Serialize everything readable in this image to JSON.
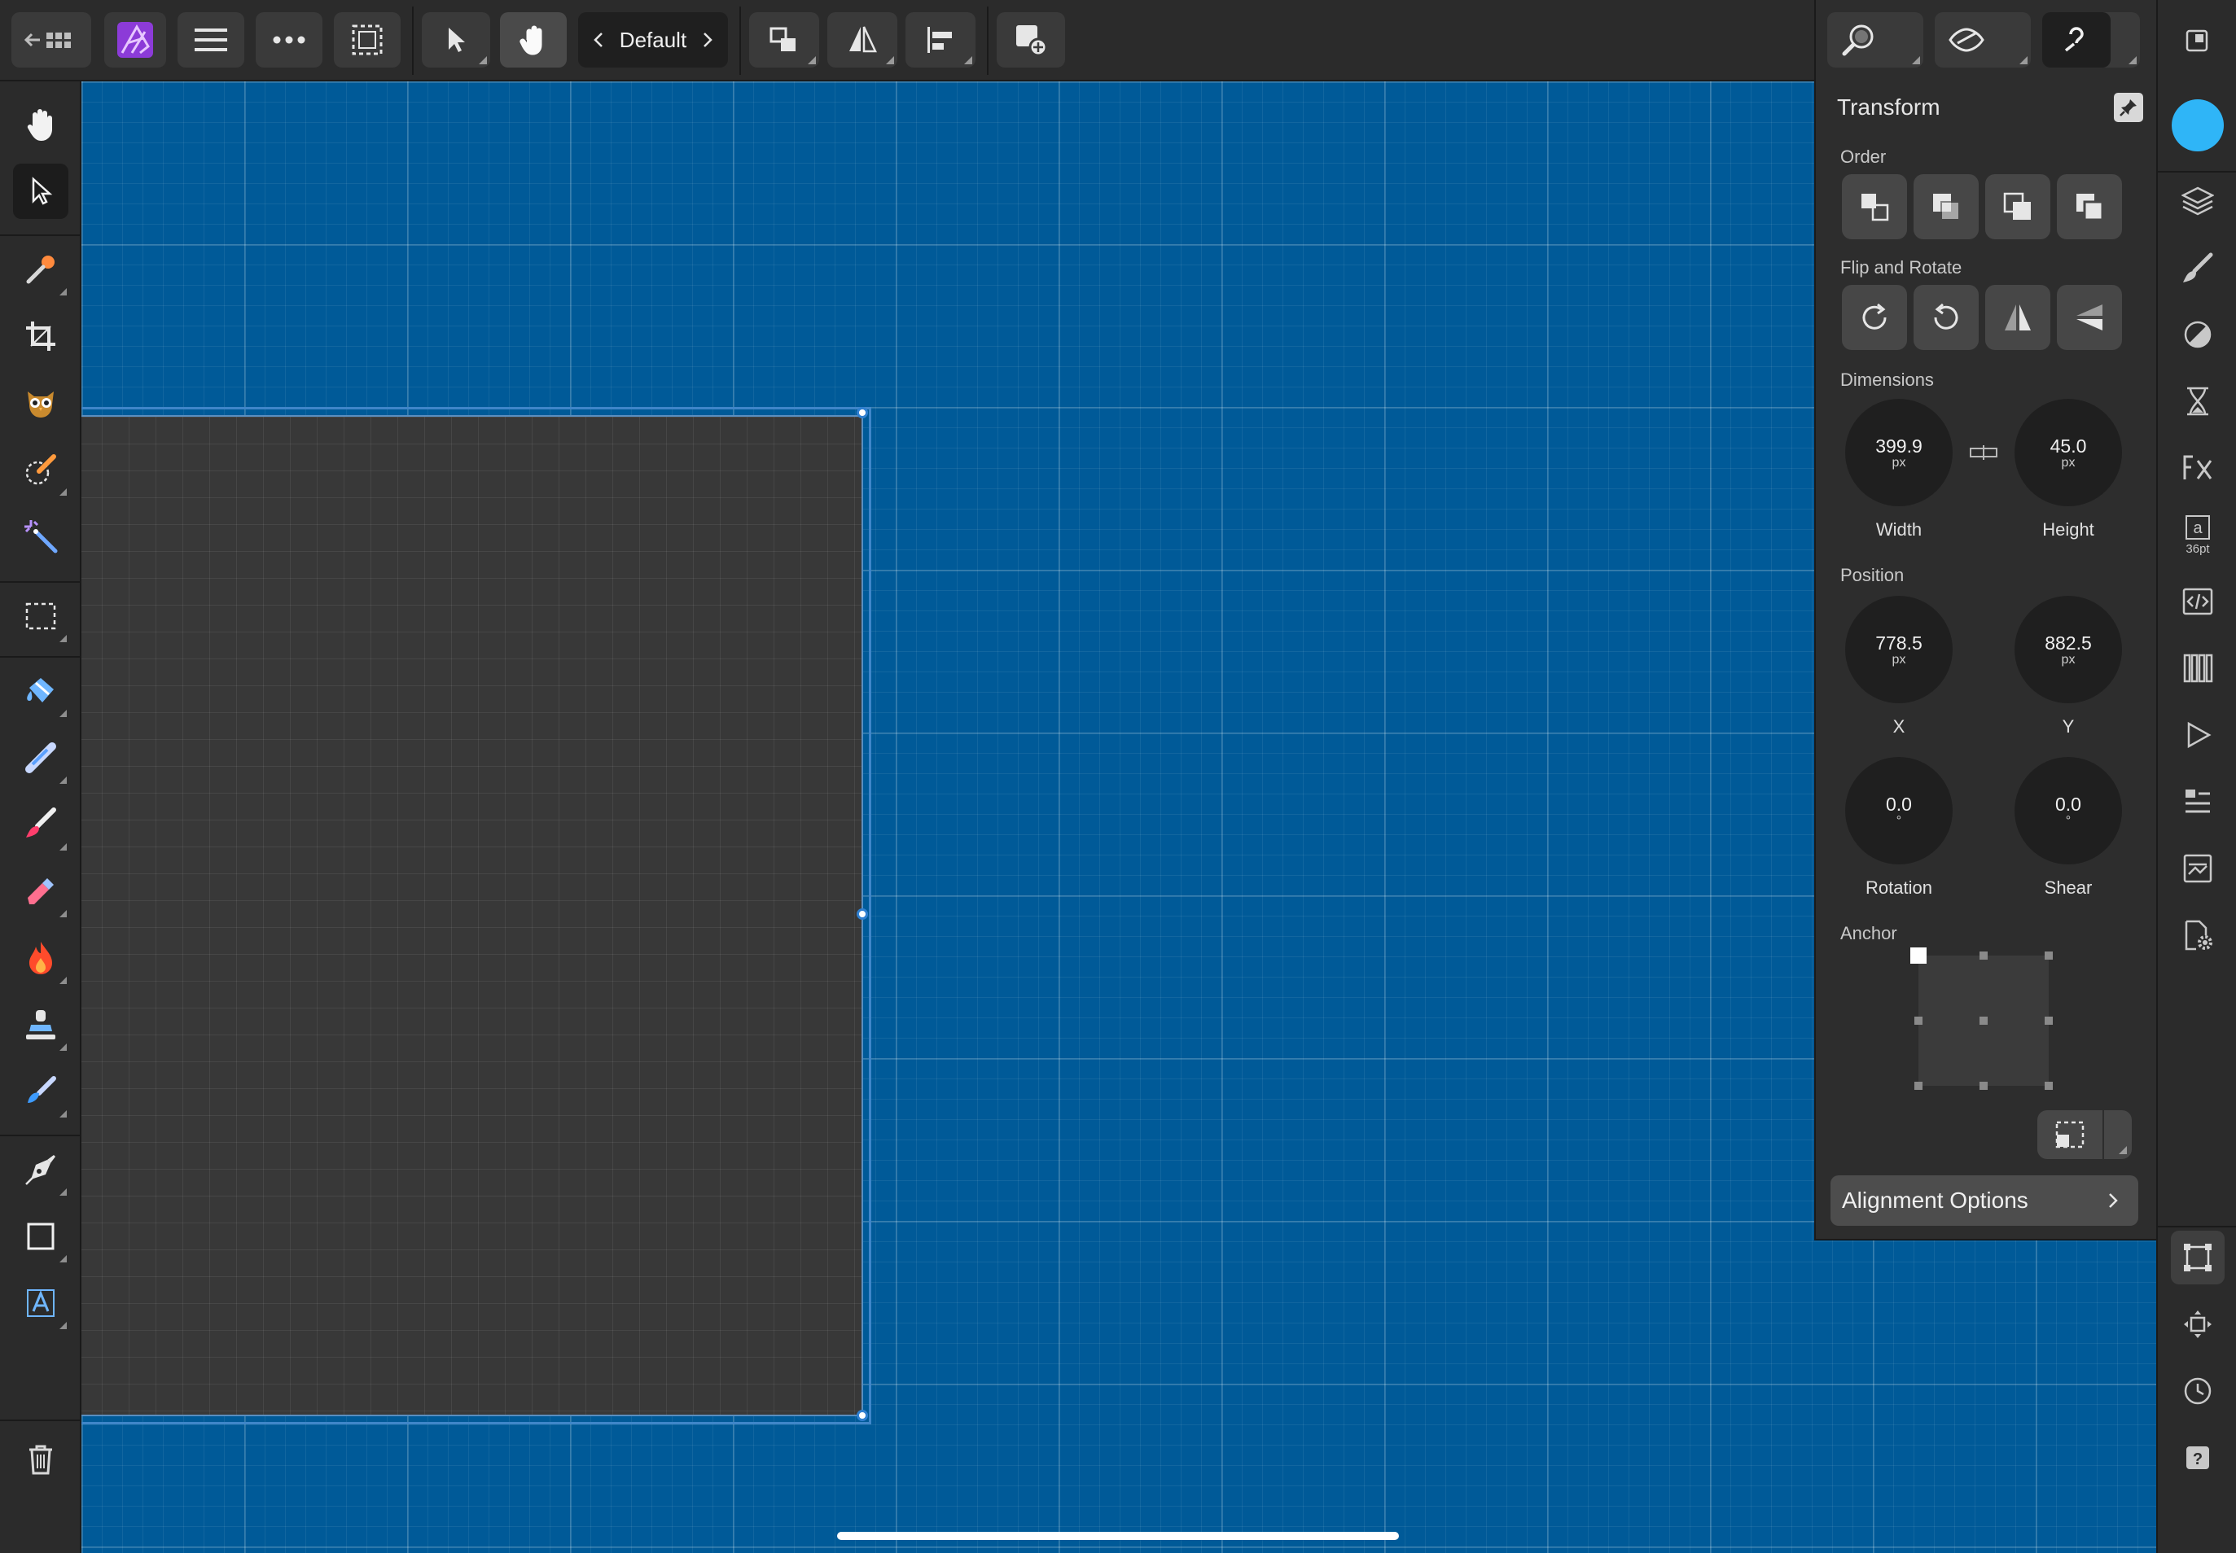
{
  "app": {
    "name": "Affinity Photo",
    "accent_color": "#a64dff",
    "canvas_color": "#005a98",
    "selection_color": "#3f86c9"
  },
  "toolbar": {
    "back_icon": "back-grid-icon",
    "persona": "Default",
    "left_buttons": [
      "app-logo-icon",
      "menu-icon",
      "more-icon",
      "marquee-selection-icon"
    ],
    "center_buttons": [
      "move-tool-icon",
      "touch-gesture-icon"
    ],
    "right_buttons": [
      "order-icon",
      "flip-icon",
      "align-icon",
      "add-layer-icon"
    ],
    "assistants": [
      "zoom-icon",
      "view-mode-icon",
      "assistant-icon"
    ]
  },
  "tools": [
    "hand-icon",
    "move-icon",
    "color-picker-icon",
    "crop-icon",
    "liquify-owl-icon",
    "selection-brush-icon",
    "magic-wand-icon",
    "marquee-icon",
    "flood-fill-icon",
    "paint-mixer-icon",
    "paint-brush-icon",
    "erase-icon",
    "burn-icon",
    "clone-stamp-icon",
    "smudge-icon",
    "pen-icon",
    "rectangle-icon",
    "artistic-text-icon",
    "delete-icon"
  ],
  "transform_panel": {
    "title": "Transform",
    "order_label": "Order",
    "flip_rotate_label": "Flip and Rotate",
    "dimensions_label": "Dimensions",
    "width": {
      "value": "399.9",
      "unit": "px",
      "label": "Width"
    },
    "height": {
      "value": "45.0",
      "unit": "px",
      "label": "Height"
    },
    "position_label": "Position",
    "x": {
      "value": "778.5",
      "unit": "px",
      "label": "X"
    },
    "y": {
      "value": "882.5",
      "unit": "px",
      "label": "Y"
    },
    "rotation": {
      "value": "0.0",
      "unit": "°",
      "label": "Rotation"
    },
    "shear": {
      "value": "0.0",
      "unit": "°",
      "label": "Shear"
    },
    "anchor_label": "Anchor",
    "alignment_options": "Alignment Options"
  },
  "studio": {
    "primary_colour": "#2fb5f7",
    "panels": [
      "layers-icon",
      "brushes-icon",
      "adjustments-icon",
      "history-hourglass-icon",
      "fx-icon",
      "character-icon",
      "code-icon",
      "channels-icon",
      "play-icon",
      "styles-icon",
      "navigator-icon",
      "document-settings-icon"
    ],
    "text_size": "36pt",
    "bottom": [
      "transform-icon",
      "transform-arrows-icon",
      "history-icon",
      "help-icon"
    ]
  }
}
